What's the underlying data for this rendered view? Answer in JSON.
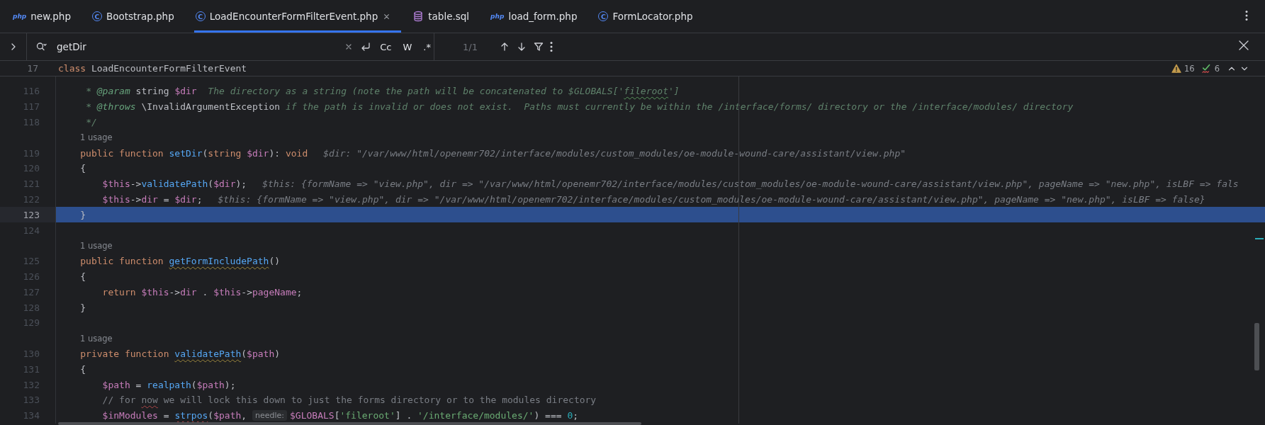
{
  "tabs": [
    {
      "label": "new.php",
      "kind": "php",
      "badge": "php",
      "selected": false,
      "closable": false
    },
    {
      "label": "Bootstrap.php",
      "kind": "class",
      "badge": "C",
      "selected": false,
      "closable": false
    },
    {
      "label": "LoadEncounterFormFilterEvent.php",
      "kind": "class",
      "badge": "C",
      "selected": true,
      "closable": true
    },
    {
      "label": "table.sql",
      "kind": "database",
      "selected": false,
      "closable": false
    },
    {
      "label": "load_form.php",
      "kind": "php",
      "badge": "php",
      "selected": false,
      "closable": false
    },
    {
      "label": "FormLocator.php",
      "kind": "class",
      "badge": "C",
      "selected": false,
      "closable": false
    }
  ],
  "find": {
    "query": "getDir",
    "options": [
      {
        "label": "Cc",
        "selected": false
      },
      {
        "label": "W",
        "selected": false
      },
      {
        "label": ".*",
        "selected": false
      }
    ],
    "count": "1/1"
  },
  "sticky_header": {
    "number": "17",
    "segments": [
      {
        "text": "class",
        "kind": "keyword"
      },
      {
        "text": " LoadEncounterFormFilterEvent",
        "kind": "plain"
      }
    ]
  },
  "inspections": {
    "warnings": "16",
    "typos": "6"
  },
  "lines": [
    {
      "kind": "doc",
      "number": "116",
      "selected": false,
      "segments": [
        {
          "text": "* ",
          "kind": "comment"
        },
        {
          "text": "@param",
          "kind": "doctag"
        },
        {
          "text": " string ",
          "kind": "plain"
        },
        {
          "text": "$dir",
          "kind": "variable"
        },
        {
          "text": "  The directory as a string (note the path will be concatenated to $GLOBALS['",
          "kind": "comment"
        },
        {
          "text": "fileroot",
          "kind": "comment",
          "misspelled": true
        },
        {
          "text": "']",
          "kind": "comment"
        }
      ]
    },
    {
      "kind": "doc",
      "number": "117",
      "selected": false,
      "segments": [
        {
          "text": "* ",
          "kind": "comment"
        },
        {
          "text": "@throws",
          "kind": "doctag"
        },
        {
          "text": " \\InvalidArgumentException",
          "kind": "plain"
        },
        {
          "text": " if the path is invalid or does not exist.  Paths must currently be within the /interface/forms/ directory or the /interface/modules/ directory",
          "kind": "comment"
        }
      ]
    },
    {
      "kind": "doc",
      "number": "118",
      "selected": false,
      "segments": [
        {
          "text": "*/",
          "kind": "comment"
        }
      ]
    },
    {
      "kind": "usage",
      "text": "1 usage"
    },
    {
      "kind": "member",
      "number": "119",
      "selected": false,
      "segments": [
        {
          "text": "public function ",
          "kind": "keyword"
        },
        {
          "text": "setDir",
          "kind": "function"
        },
        {
          "text": "(",
          "kind": "plain"
        },
        {
          "text": "string ",
          "kind": "keyword"
        },
        {
          "text": "$dir",
          "kind": "variable"
        },
        {
          "text": "): ",
          "kind": "plain"
        },
        {
          "text": "void",
          "kind": "keyword"
        },
        {
          "text": "$dir: \"/var/www/html/openemr702/interface/modules/custom_modules/oe-module-wound-care/assistant/view.php\"",
          "kind": "hint"
        }
      ]
    },
    {
      "kind": "member",
      "number": "120",
      "selected": false,
      "segments": [
        {
          "text": "{",
          "kind": "plain"
        }
      ]
    },
    {
      "kind": "statement",
      "number": "121",
      "selected": false,
      "segments": [
        {
          "text": "$this",
          "kind": "variable"
        },
        {
          "text": "->",
          "kind": "plain"
        },
        {
          "text": "validatePath",
          "kind": "function"
        },
        {
          "text": "(",
          "kind": "plain"
        },
        {
          "text": "$dir",
          "kind": "variable"
        },
        {
          "text": ");",
          "kind": "plain"
        },
        {
          "text": "$this: {formName => \"view.php\", dir => \"/var/www/html/openemr702/interface/modules/custom_modules/oe-module-wound-care/assistant/view.php\", pageName => \"new.php\", isLBF => fals",
          "kind": "hint"
        }
      ]
    },
    {
      "kind": "statement",
      "number": "122",
      "selected": false,
      "segments": [
        {
          "text": "$this",
          "kind": "variable"
        },
        {
          "text": "->",
          "kind": "plain"
        },
        {
          "text": "dir",
          "kind": "variable"
        },
        {
          "text": " = ",
          "kind": "plain"
        },
        {
          "text": "$dir",
          "kind": "variable"
        },
        {
          "text": ";",
          "kind": "plain"
        },
        {
          "text": "$this: {formName => \"view.php\", dir => \"/var/www/html/openemr702/interface/modules/custom_modules/oe-module-wound-care/assistant/view.php\", pageName => \"new.php\", isLBF => false}",
          "kind": "hint"
        }
      ]
    },
    {
      "kind": "member",
      "number": "123",
      "selected": true,
      "segments": [
        {
          "text": "}",
          "kind": "plain"
        }
      ]
    },
    {
      "kind": "blank",
      "number": "124",
      "selected": false
    },
    {
      "kind": "usage",
      "text": "1 usage"
    },
    {
      "kind": "member",
      "number": "125",
      "selected": false,
      "segments": [
        {
          "text": "public function ",
          "kind": "keyword"
        },
        {
          "text": "getFormIncludePath",
          "kind": "function",
          "warning": true
        },
        {
          "text": "()",
          "kind": "plain"
        }
      ]
    },
    {
      "kind": "member",
      "number": "126",
      "selected": false,
      "segments": [
        {
          "text": "{",
          "kind": "plain"
        }
      ]
    },
    {
      "kind": "statement",
      "number": "127",
      "selected": false,
      "segments": [
        {
          "text": "return ",
          "kind": "keyword"
        },
        {
          "text": "$this",
          "kind": "variable"
        },
        {
          "text": "->",
          "kind": "plain"
        },
        {
          "text": "dir",
          "kind": "variable"
        },
        {
          "text": " . ",
          "kind": "plain"
        },
        {
          "text": "$this",
          "kind": "variable"
        },
        {
          "text": "->",
          "kind": "plain"
        },
        {
          "text": "pageName",
          "kind": "variable"
        },
        {
          "text": ";",
          "kind": "plain"
        }
      ]
    },
    {
      "kind": "member",
      "number": "128",
      "selected": false,
      "segments": [
        {
          "text": "}",
          "kind": "plain"
        }
      ]
    },
    {
      "kind": "blank",
      "number": "129",
      "selected": false
    },
    {
      "kind": "usage",
      "text": "1 usage"
    },
    {
      "kind": "member",
      "number": "130",
      "selected": false,
      "segments": [
        {
          "text": "private function ",
          "kind": "keyword"
        },
        {
          "text": "validatePath",
          "kind": "function",
          "warning": true
        },
        {
          "text": "(",
          "kind": "plain"
        },
        {
          "text": "$path",
          "kind": "variable"
        },
        {
          "text": ")",
          "kind": "plain"
        }
      ]
    },
    {
      "kind": "member",
      "number": "131",
      "selected": false,
      "segments": [
        {
          "text": "{",
          "kind": "plain"
        }
      ]
    },
    {
      "kind": "statement",
      "number": "132",
      "selected": false,
      "segments": [
        {
          "text": "$path",
          "kind": "variable"
        },
        {
          "text": " = ",
          "kind": "plain"
        },
        {
          "text": "realpath",
          "kind": "function"
        },
        {
          "text": "(",
          "kind": "plain"
        },
        {
          "text": "$path",
          "kind": "variable"
        },
        {
          "text": ");",
          "kind": "plain"
        }
      ]
    },
    {
      "kind": "statement",
      "number": "133",
      "selected": false,
      "segments": [
        {
          "text": "// for ",
          "kind": "line-comment"
        },
        {
          "text": "now",
          "kind": "line-comment",
          "error": true
        },
        {
          "text": " we will lock this down to just the forms directory or to the modules directory",
          "kind": "line-comment"
        }
      ]
    },
    {
      "kind": "statement",
      "number": "134",
      "selected": false,
      "segments": [
        {
          "text": "$inModules",
          "kind": "variable"
        },
        {
          "text": " = ",
          "kind": "plain"
        },
        {
          "text": "strpos",
          "kind": "function",
          "error": true
        },
        {
          "text": "(",
          "kind": "plain"
        },
        {
          "text": "$path",
          "kind": "variable"
        },
        {
          "text": ", ",
          "kind": "plain"
        },
        {
          "text": "needle:",
          "kind": "inlay"
        },
        {
          "text": "$GLOBALS",
          "kind": "variable"
        },
        {
          "text": "[",
          "kind": "plain"
        },
        {
          "text": "'fileroot'",
          "kind": "string"
        },
        {
          "text": "] . ",
          "kind": "plain"
        },
        {
          "text": "'/interface/modules/'",
          "kind": "string"
        },
        {
          "text": ") === ",
          "kind": "plain"
        },
        {
          "text": "0",
          "kind": "number"
        },
        {
          "text": ";",
          "kind": "plain"
        }
      ]
    }
  ]
}
